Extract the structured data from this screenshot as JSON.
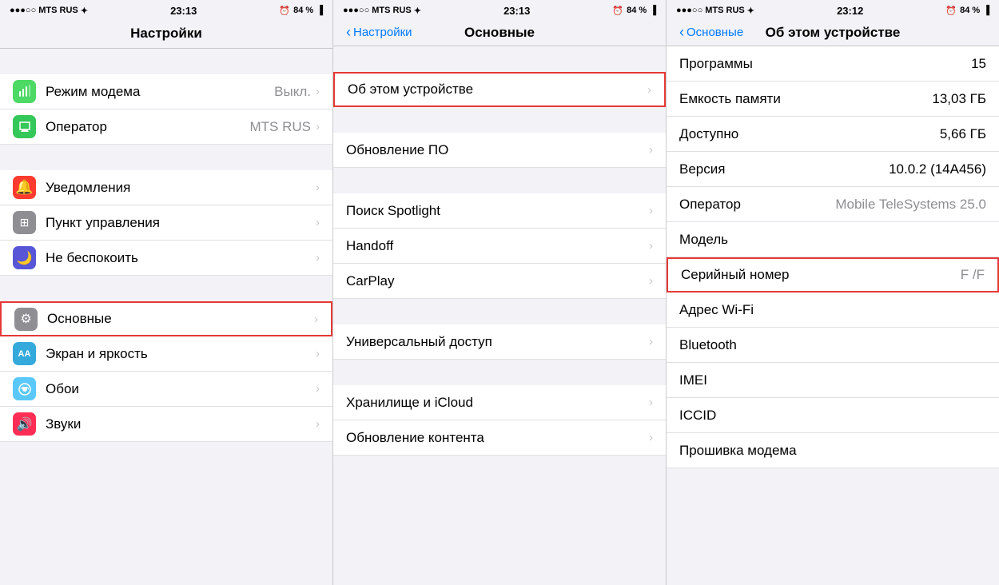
{
  "screens": [
    {
      "id": "screen1",
      "statusBar": {
        "left": "●●●○○ MTS RUS ✦",
        "center": "23:13",
        "right": "⏰ 84 % ▐"
      },
      "navTitle": "Настройки",
      "groups": [
        {
          "items": [
            {
              "icon": "📶",
              "iconClass": "icon-green",
              "label": "Режим модема",
              "value": "Выкл.",
              "chevron": true
            },
            {
              "icon": "📞",
              "iconClass": "icon-green2",
              "label": "Оператор",
              "value": "MTS RUS",
              "chevron": true
            }
          ]
        },
        {
          "items": [
            {
              "icon": "🔔",
              "iconClass": "icon-red",
              "label": "Уведомления",
              "value": "",
              "chevron": true
            },
            {
              "icon": "⚙",
              "iconClass": "icon-gray",
              "label": "Пункт управления",
              "value": "",
              "chevron": true
            },
            {
              "icon": "🌙",
              "iconClass": "icon-purple",
              "label": "Не беспокоить",
              "value": "",
              "chevron": true
            }
          ]
        },
        {
          "items": [
            {
              "icon": "⚙",
              "iconClass": "icon-gray",
              "label": "Основные",
              "value": "",
              "chevron": true,
              "highlighted": true
            },
            {
              "icon": "AA",
              "iconClass": "icon-navy",
              "label": "Экран и яркость",
              "value": "",
              "chevron": true
            },
            {
              "icon": "✿",
              "iconClass": "icon-teal",
              "label": "Обои",
              "value": "",
              "chevron": true
            },
            {
              "icon": "♪",
              "iconClass": "icon-pink",
              "label": "Звуки",
              "value": "",
              "chevron": true
            }
          ]
        }
      ]
    },
    {
      "id": "screen2",
      "statusBar": {
        "left": "●●●○○ MTS RUS ✦",
        "center": "23:13",
        "right": "⏰ 84 % ▐"
      },
      "navBack": "Настройки",
      "navTitle": "Основные",
      "groups": [
        {
          "items": [
            {
              "label": "Об этом устройстве",
              "chevron": true,
              "highlighted": true
            }
          ]
        },
        {
          "items": [
            {
              "label": "Обновление ПО",
              "chevron": true
            }
          ]
        },
        {
          "items": [
            {
              "label": "Поиск Spotlight",
              "chevron": true
            },
            {
              "label": "Handoff",
              "chevron": true
            },
            {
              "label": "CarPlay",
              "chevron": true
            }
          ]
        },
        {
          "items": [
            {
              "label": "Универсальный доступ",
              "chevron": true
            }
          ]
        },
        {
          "items": [
            {
              "label": "Хранилище и iCloud",
              "chevron": true
            },
            {
              "label": "Обновление контента",
              "chevron": true
            }
          ]
        }
      ]
    },
    {
      "id": "screen3",
      "statusBar": {
        "left": "●●●○○ MTS RUS ✦",
        "center": "23:12",
        "right": "⏰ 84 % ▐"
      },
      "navBack": "Основные",
      "navTitle": "Об этом устройстве",
      "infoRows": [
        {
          "label": "Программы",
          "value": "15"
        },
        {
          "label": "Емкость памяти",
          "value": "13,03 ГБ"
        },
        {
          "label": "Доступно",
          "value": "5,66 ГБ"
        },
        {
          "label": "Версия",
          "value": "10.0.2 (14A456)"
        },
        {
          "label": "Оператор",
          "value": "Mobile TeleSystems 25.0"
        },
        {
          "label": "Модель",
          "value": ""
        },
        {
          "label": "Серийный номер",
          "value": "F                    /F",
          "highlighted": true
        },
        {
          "label": "Адрес Wi-Fi",
          "value": ""
        },
        {
          "label": "Bluetooth",
          "value": ""
        },
        {
          "label": "IMEI",
          "value": ""
        },
        {
          "label": "ICCID",
          "value": ""
        },
        {
          "label": "Прошивка модема",
          "value": ""
        }
      ]
    }
  ],
  "icons": {
    "modem": "📡",
    "operator": "📞",
    "notifications": "🔔",
    "control_center": "⊞",
    "do_not_disturb": "🌙",
    "general": "⚙",
    "display": "AA",
    "wallpaper": "✿",
    "sounds": "♫",
    "chevron": "›",
    "back_chevron": "‹"
  }
}
